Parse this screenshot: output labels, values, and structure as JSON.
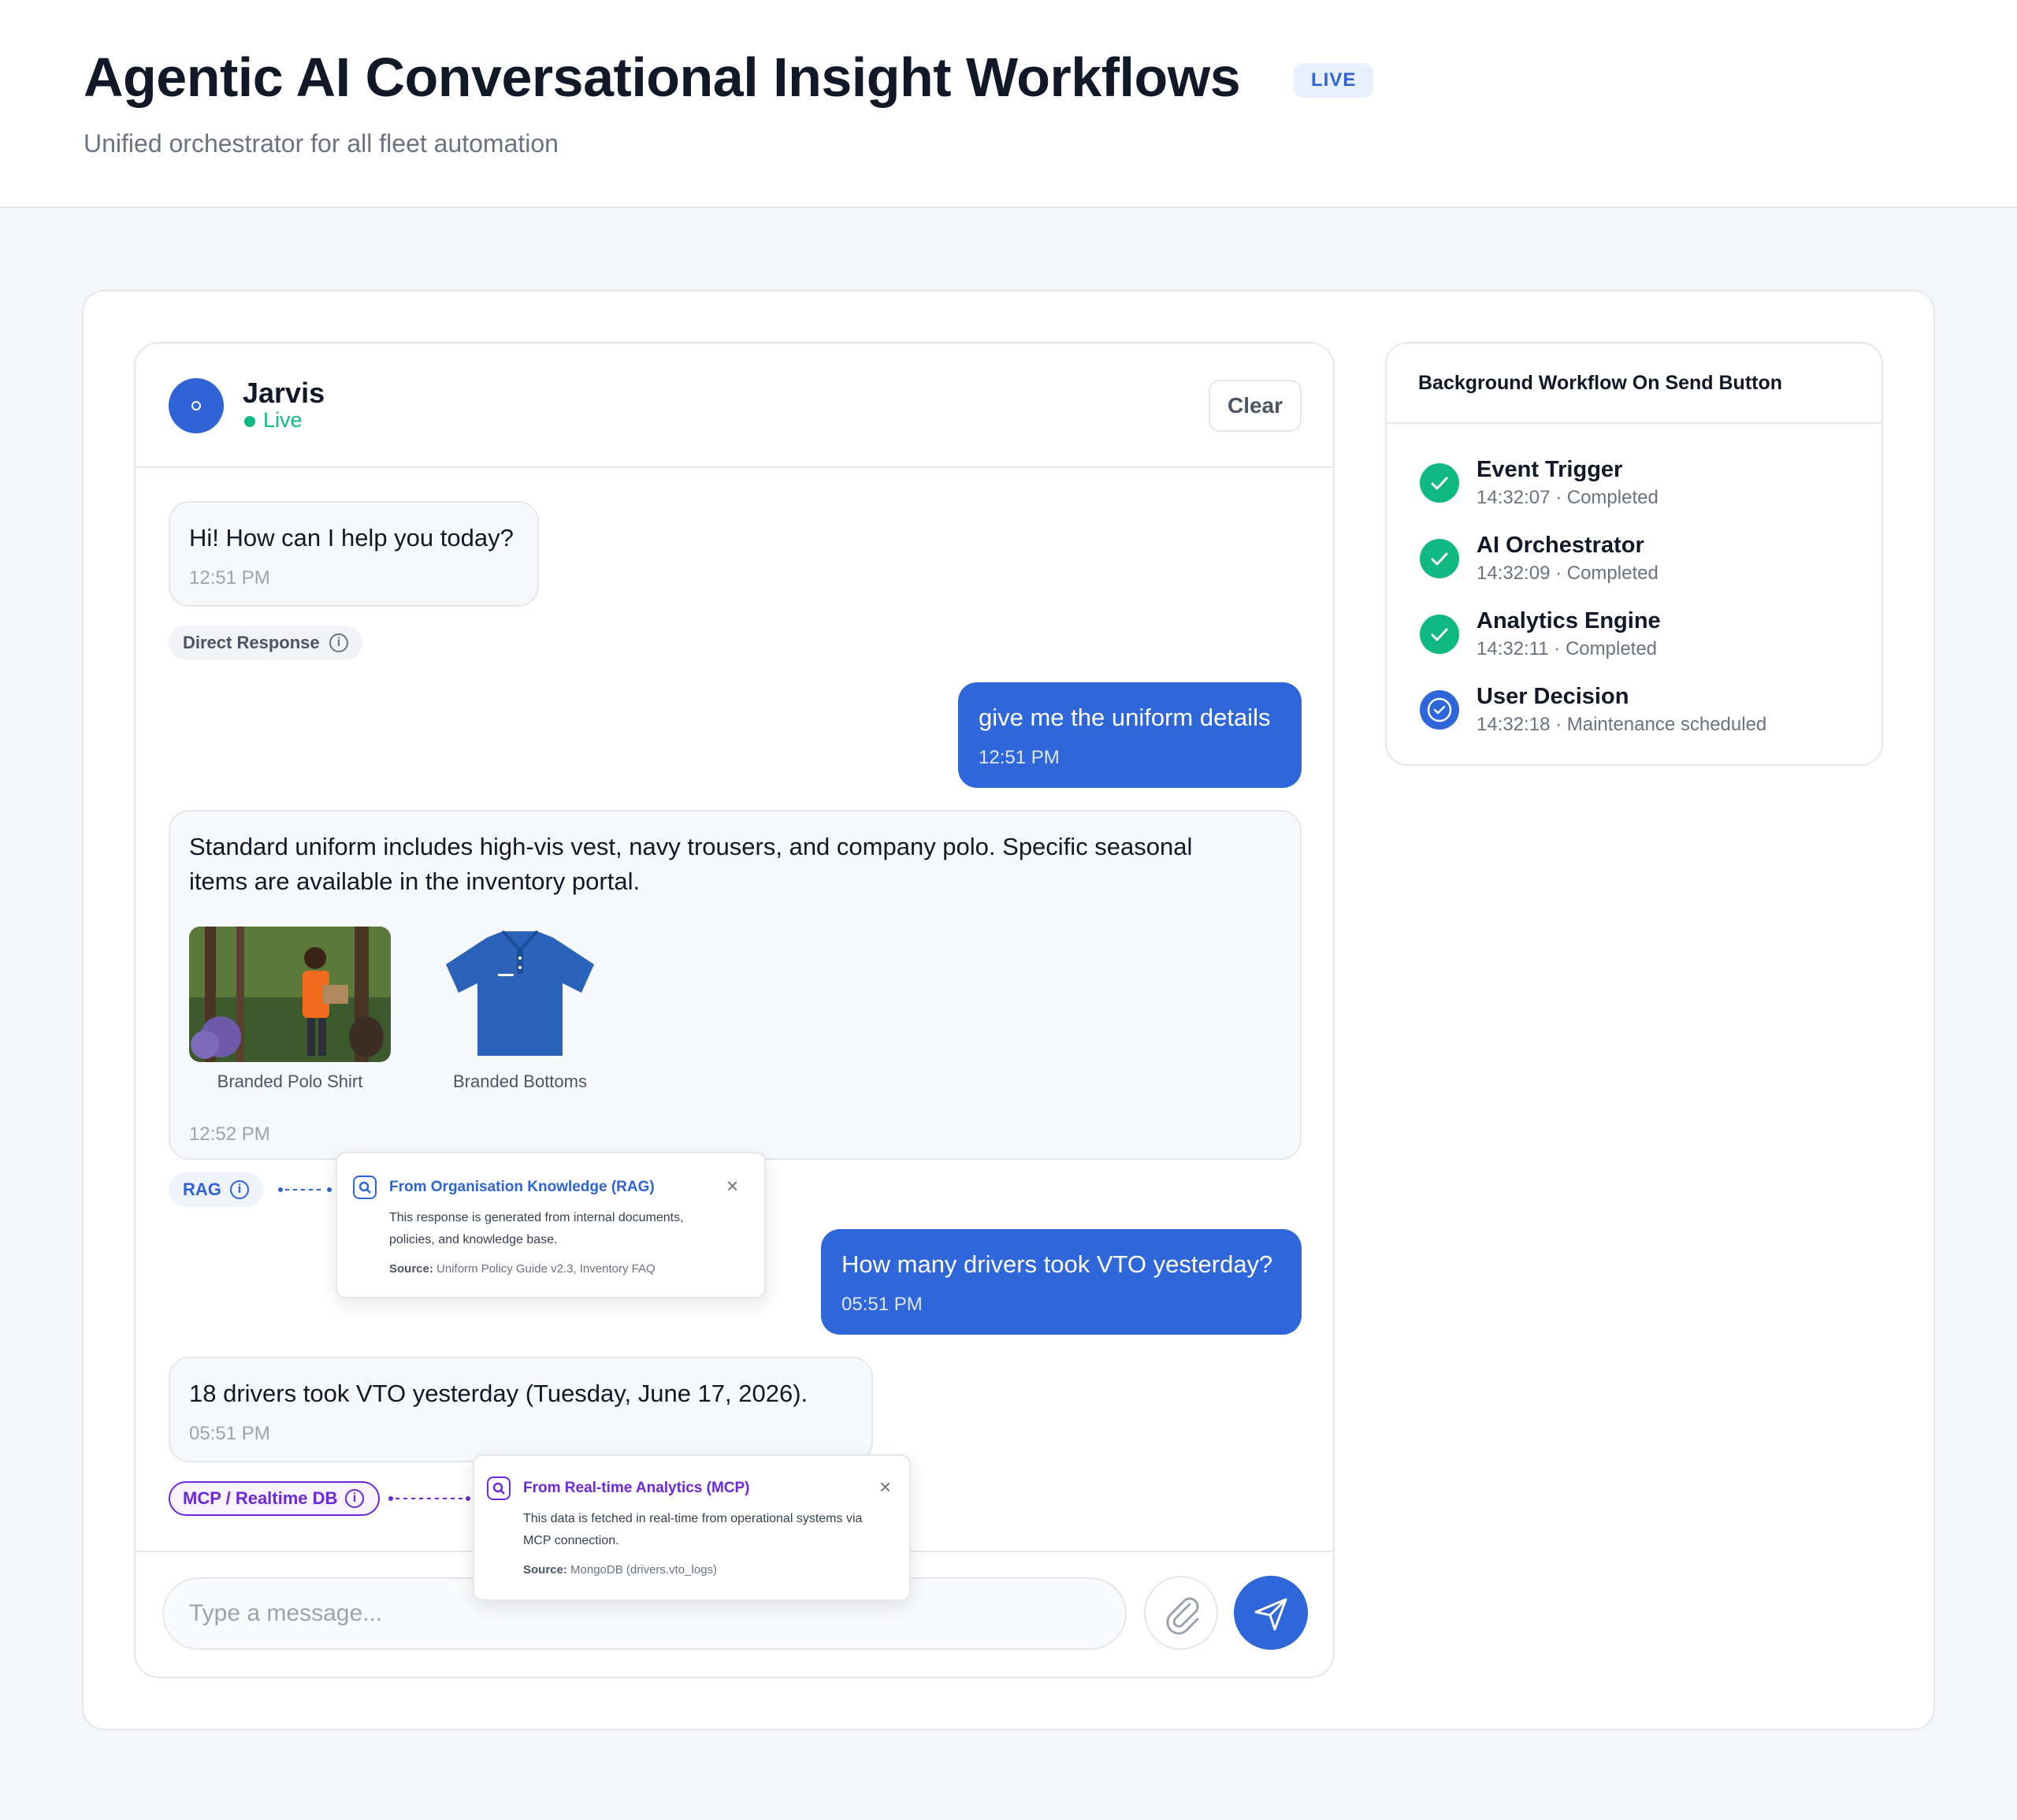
{
  "header": {
    "title": "Agentic AI Conversational Insight Workflows",
    "badge": "LIVE",
    "subtitle": "Unified orchestrator for all fleet automation"
  },
  "chat": {
    "agent_name": "Jarvis",
    "status": "Live",
    "clear_label": "Clear",
    "messages": [
      {
        "role": "bot",
        "text": "Hi! How can I help you today?",
        "time": "12:51 PM",
        "tag": "Direct Response"
      },
      {
        "role": "user",
        "text": "give me the uniform details",
        "time": "12:51 PM"
      },
      {
        "role": "bot",
        "text_lines": [
          "Standard uniform includes high-vis vest, navy trousers, and company polo. Specific seasonal",
          "items are available in the inventory portal."
        ],
        "time": "12:52 PM",
        "tag": "RAG",
        "images": [
          {
            "caption": "Branded Polo Shirt"
          },
          {
            "caption": "Branded Bottoms"
          }
        ]
      },
      {
        "role": "user",
        "text": "How many drivers took VTO yesterday?",
        "time": "05:51 PM"
      },
      {
        "role": "bot",
        "text": "18 drivers took VTO yesterday (Tuesday, June 17, 2026).",
        "time": "05:51 PM",
        "tag": "MCP / Realtime DB"
      }
    ],
    "rag_popover": {
      "title": "From Organisation Knowledge (RAG)",
      "body_lines": [
        "This response is generated from internal documents,",
        "policies, and knowledge base."
      ],
      "source_label": "Source:",
      "source": "Uniform Policy Guide v2.3, Inventory FAQ"
    },
    "mcp_popover": {
      "title": "From Real-time Analytics (MCP)",
      "body_lines": [
        "This data is fetched in real-time from operational systems via",
        "MCP connection."
      ],
      "source_label": "Source:",
      "source": "MongoDB (drivers.vto_logs)"
    },
    "input_placeholder": "Type a message...",
    "icons": {
      "attach": "paperclip-icon",
      "send": "send-icon",
      "info": "info-icon",
      "search": "search-icon",
      "close": "close-icon"
    }
  },
  "workflow": {
    "title": "Background Workflow On Send Button",
    "steps": [
      {
        "name": "Event Trigger",
        "meta": "14:32:07 · Completed",
        "state": "completed"
      },
      {
        "name": "AI Orchestrator",
        "meta": "14:32:09 · Completed",
        "state": "completed"
      },
      {
        "name": "Analytics Engine",
        "meta": "14:32:11 · Completed",
        "state": "completed"
      },
      {
        "name": "User Decision",
        "meta": "14:32:18 · Maintenance scheduled",
        "state": "active"
      }
    ]
  },
  "colors": {
    "primary": "#2f66d9",
    "success": "#10b981",
    "rag": "#2f63d6",
    "mcp": "#6d28d9"
  }
}
